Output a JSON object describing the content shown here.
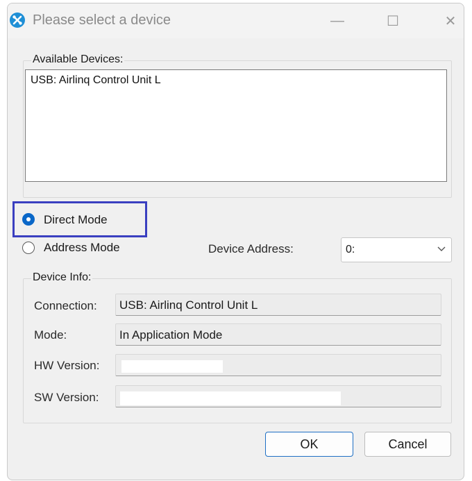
{
  "window": {
    "title": "Please select a device",
    "icon": "tools-icon",
    "controls": {
      "minimize": "—",
      "maximize": "☐",
      "close": "✕"
    }
  },
  "available_devices": {
    "label": "Available Devices:",
    "items": [
      "USB: Airlinq Control Unit L"
    ]
  },
  "modes": {
    "direct": {
      "label": "Direct Mode",
      "checked": true
    },
    "address": {
      "label": "Address Mode",
      "checked": false
    }
  },
  "device_address": {
    "label": "Device Address:",
    "value": "0:"
  },
  "device_info": {
    "label": "Device Info:",
    "connection": {
      "label": "Connection:",
      "value": "USB: Airlinq Control Unit L"
    },
    "mode": {
      "label": "Mode:",
      "value": "In Application Mode"
    },
    "hw_version": {
      "label": "HW Version:",
      "value": ""
    },
    "sw_version": {
      "label": "SW Version:",
      "value": ""
    }
  },
  "buttons": {
    "ok": "OK",
    "cancel": "Cancel"
  },
  "colors": {
    "accent": "#0a67c8",
    "highlight_box": "#3a3fc0",
    "dialog_bg": "#f0f0f0"
  }
}
